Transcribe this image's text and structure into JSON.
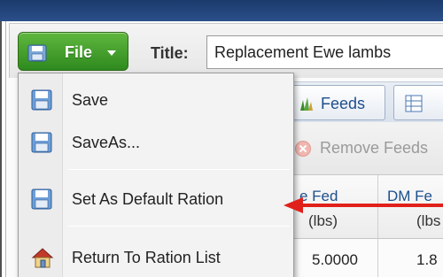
{
  "colors": {
    "file_button": "#3f9e2a",
    "arrow": "#e0201a",
    "link_text": "#1d4f8d"
  },
  "toolbar": {
    "file_label": "File",
    "title_label": "Title:",
    "title_value": "Replacement Ewe lambs"
  },
  "file_menu": {
    "items": [
      {
        "label": "Save",
        "icon": "floppy-disk-icon"
      },
      {
        "label": "SaveAs...",
        "icon": "floppy-disk-icon"
      },
      {
        "label": "Set As Default Ration",
        "icon": "floppy-disk-icon"
      },
      {
        "label": "Return To Ration List",
        "icon": "home-icon"
      }
    ]
  },
  "tabs": [
    {
      "label": "Feeds",
      "icon": "feeds-icon"
    },
    {
      "label": "",
      "icon": "table-icon"
    }
  ],
  "actions": {
    "remove_feeds": "Remove Feeds"
  },
  "grid": {
    "columns": [
      {
        "header": "e Fed",
        "unit": "(lbs)"
      },
      {
        "header": "DM Fe",
        "unit": "(lbs"
      }
    ],
    "row": [
      "5.0000",
      "1.8"
    ]
  }
}
